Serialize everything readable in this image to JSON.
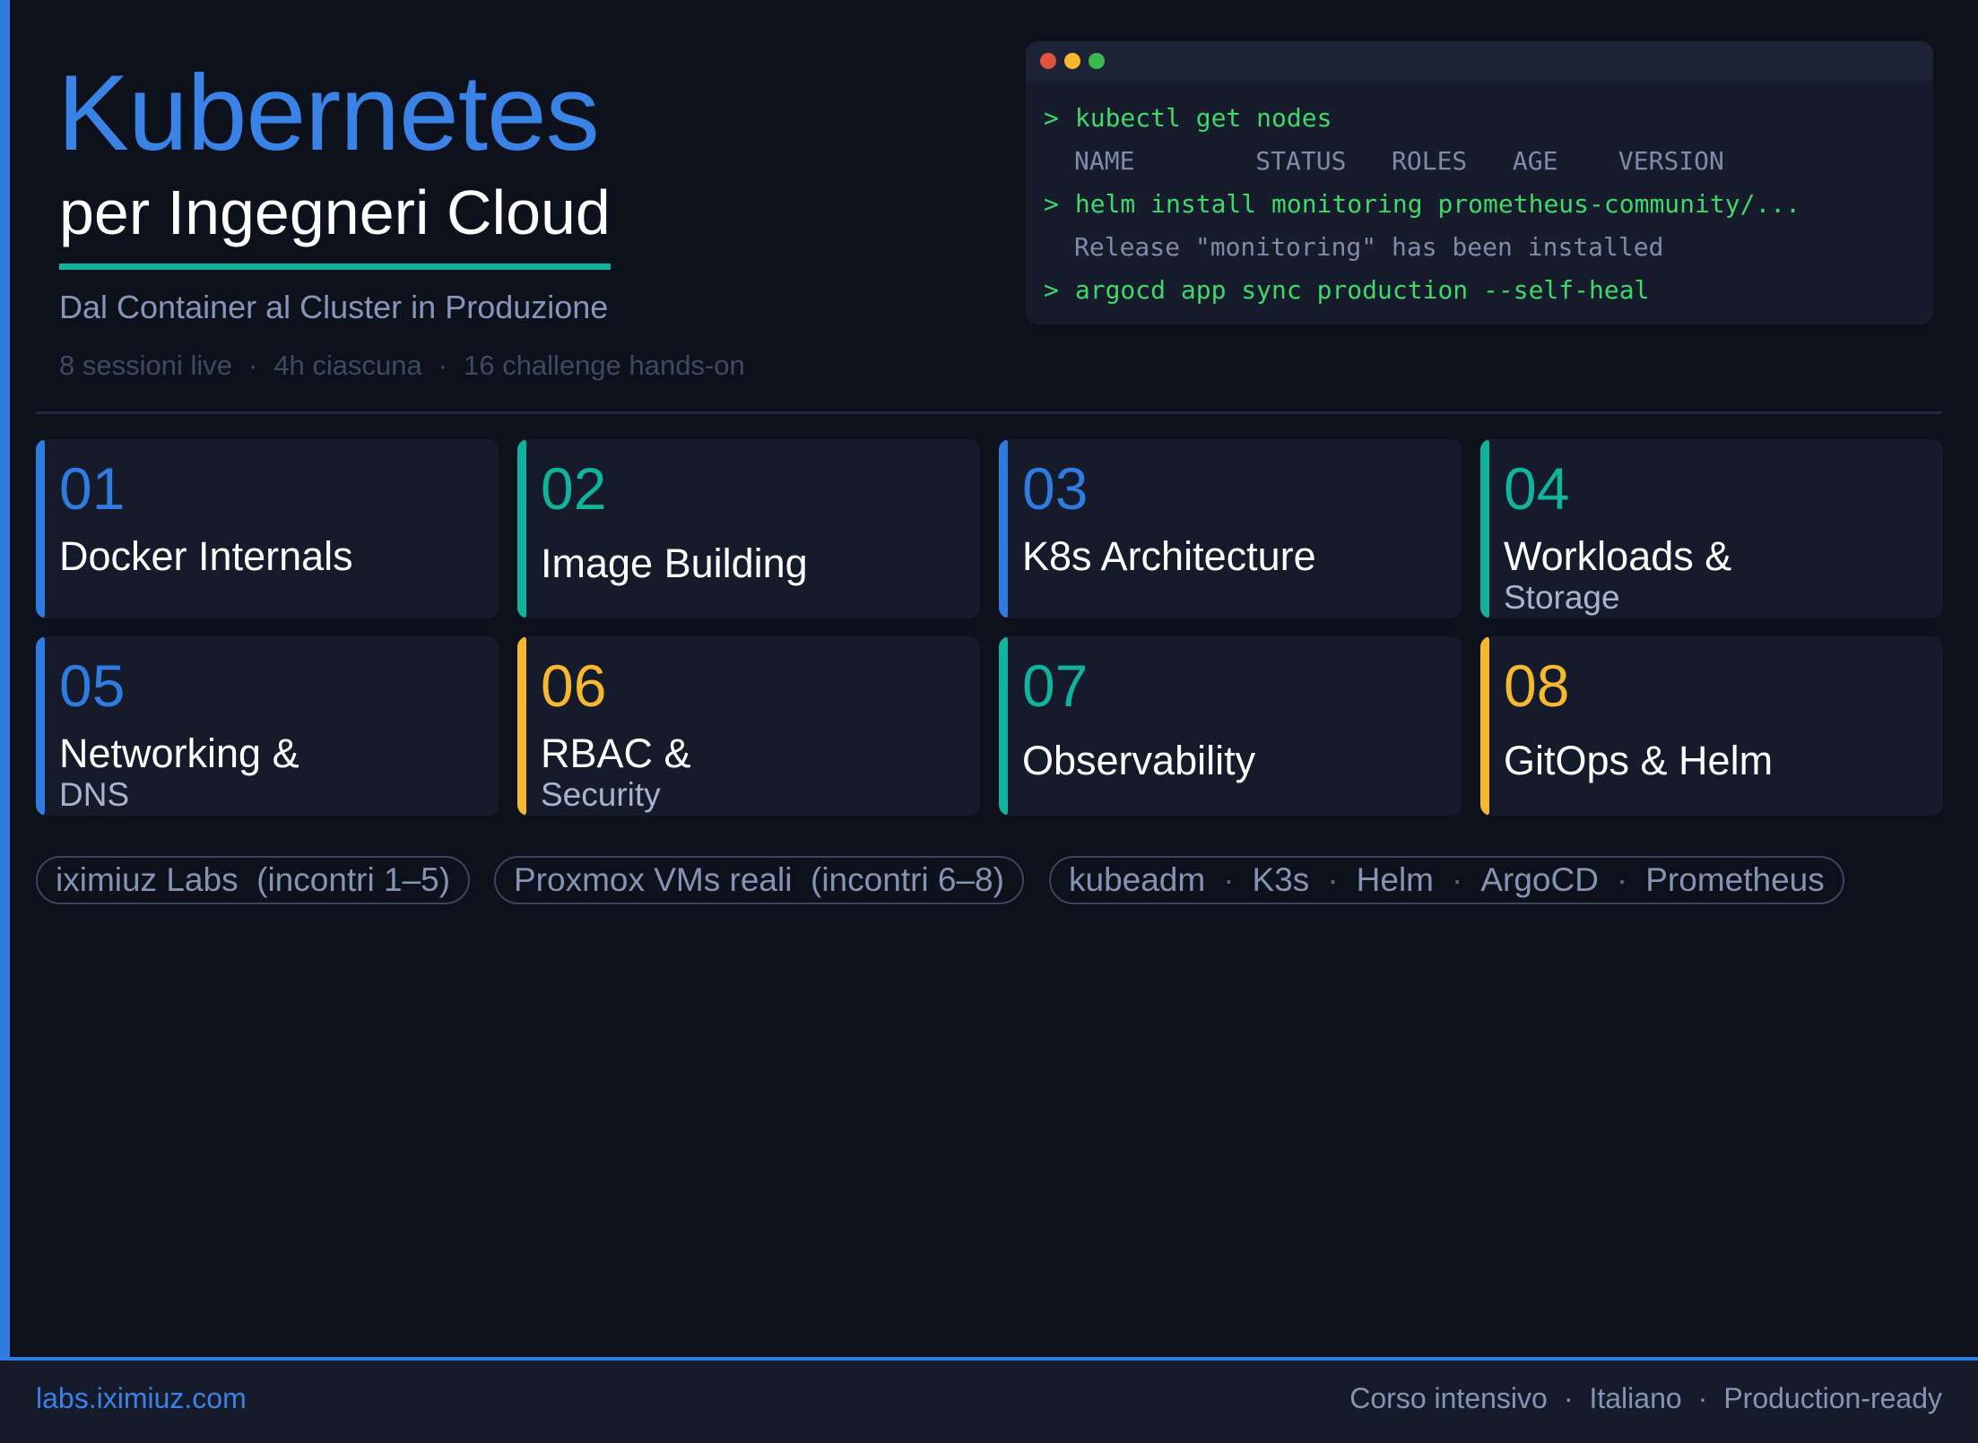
{
  "header": {
    "title": "Kubernetes",
    "subtitle": "per Ingegneri Cloud",
    "tagline": "Dal Container al Cluster in Produzione",
    "meta": [
      "8 sessioni live",
      "4h ciascuna",
      "16 challenge hands-on"
    ]
  },
  "terminal": {
    "lines": [
      {
        "prompt": ">",
        "text": "kubectl get nodes"
      },
      {
        "text": "NAME        STATUS   ROLES   AGE    VERSION"
      },
      {
        "prompt": ">",
        "text": "helm install monitoring prometheus-community/..."
      },
      {
        "text": "Release \"monitoring\" has been installed"
      },
      {
        "prompt": ">",
        "text": "argocd app sync production --self-heal"
      }
    ]
  },
  "modules": [
    {
      "num": "01",
      "label": "Docker Internals",
      "color": "#2f7be0"
    },
    {
      "num": "02",
      "label": "Image Building",
      "color": "#10b39b"
    },
    {
      "num": "03",
      "label": "K8s Architecture",
      "color": "#2f7be0"
    },
    {
      "num": "04",
      "label": "Workloads &",
      "label2": "Storage",
      "color": "#10b39b"
    },
    {
      "num": "05",
      "label": "Networking &",
      "label2": "DNS",
      "color": "#2f7be0"
    },
    {
      "num": "06",
      "label": "RBAC &",
      "label2": "Security",
      "color": "#f5b82e"
    },
    {
      "num": "07",
      "label": "Observability",
      "color": "#10b39b"
    },
    {
      "num": "08",
      "label": "GitOps & Helm",
      "color": "#f5b82e"
    }
  ],
  "pills": {
    "labs": "iximiuz Labs  (incontri 1–5)",
    "proxmox": "Proxmox VMs reali  (incontri 6–8)",
    "tools": [
      "kubeadm",
      "K3s",
      "Helm",
      "ArgoCD",
      "Prometheus"
    ]
  },
  "footer": {
    "url": "labs.iximiuz.com",
    "tags": [
      "Corso intensivo",
      "Italiano",
      "Production-ready"
    ]
  }
}
